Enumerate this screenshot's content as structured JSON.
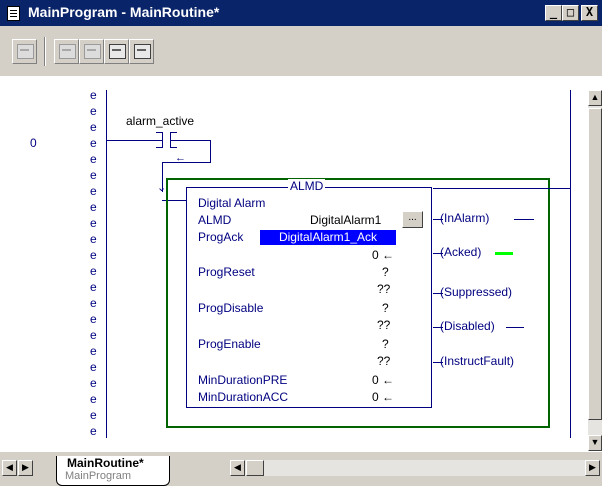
{
  "window": {
    "title": "MainProgram - MainRoutine*",
    "title_icon": "document-icon",
    "controls": [
      "_",
      "□",
      "X"
    ]
  },
  "toolbar": {
    "buttons": [
      "rung-button",
      "branch-button",
      "branch-level-button",
      "xic-button",
      "xio-button"
    ]
  },
  "ladder": {
    "rung_number": "0",
    "rung_marker": "e",
    "contact_tag": "alarm_active",
    "block": {
      "title": "ALMD",
      "description": "Digital Alarm",
      "rows": [
        {
          "label": "ALMD",
          "value": "DigitalAlarm1"
        },
        {
          "label": "ProgAck",
          "value": "DigitalAlarm1_Ack"
        },
        {
          "label": "",
          "value": "0 ←"
        },
        {
          "label": "ProgReset",
          "value": "?"
        },
        {
          "label": "",
          "value": "??"
        },
        {
          "label": "ProgDisable",
          "value": "?"
        },
        {
          "label": "",
          "value": "??"
        },
        {
          "label": "ProgEnable",
          "value": "?"
        },
        {
          "label": "",
          "value": "??"
        },
        {
          "label": "MinDurationPRE",
          "value": "0 ←"
        },
        {
          "label": "MinDurationACC",
          "value": "0 ←"
        }
      ],
      "browse_button": "...",
      "outputs": [
        "InAlarm",
        "Acked",
        "Suppressed",
        "Disabled",
        "InstructFault"
      ]
    },
    "colors": {
      "wire": "#000080",
      "block_border": "#006400",
      "selection": "#0000ff",
      "energized": "#00ff00"
    }
  },
  "tabs": {
    "routine_name": "MainRoutine*",
    "program_name": "MainProgram"
  }
}
